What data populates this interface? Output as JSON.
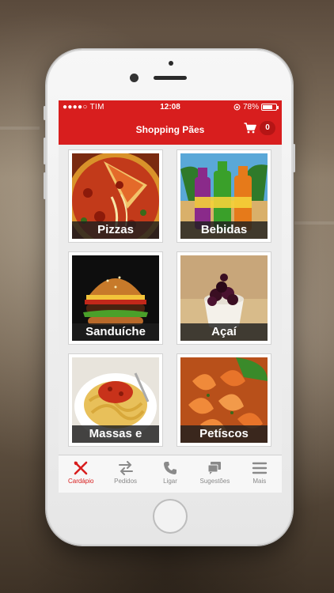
{
  "status_bar": {
    "carrier": "●●●●○ TIM",
    "time": "12:08",
    "battery": "78%",
    "battery_level": 0.78
  },
  "header": {
    "title": "Shopping Pães",
    "cart_count": "0"
  },
  "menu": {
    "items": [
      {
        "label": "Pizzas"
      },
      {
        "label": "Bebidas"
      },
      {
        "label": "Sanduíche"
      },
      {
        "label": "Açaí"
      },
      {
        "label": "Massas e"
      },
      {
        "label": "Petíscos"
      }
    ]
  },
  "tabbar": {
    "tabs": [
      {
        "label": "Cardápio",
        "icon": "fork-knife-icon",
        "active": true
      },
      {
        "label": "Pedidos",
        "icon": "swap-arrows-icon",
        "active": false
      },
      {
        "label": "Ligar",
        "icon": "phone-icon",
        "active": false
      },
      {
        "label": "Sugestões",
        "icon": "chat-bubbles-icon",
        "active": false
      },
      {
        "label": "Mais",
        "icon": "menu-icon",
        "active": false
      }
    ]
  },
  "colors": {
    "brand_red": "#d81e1e",
    "tab_inactive": "#8a8a8a"
  }
}
